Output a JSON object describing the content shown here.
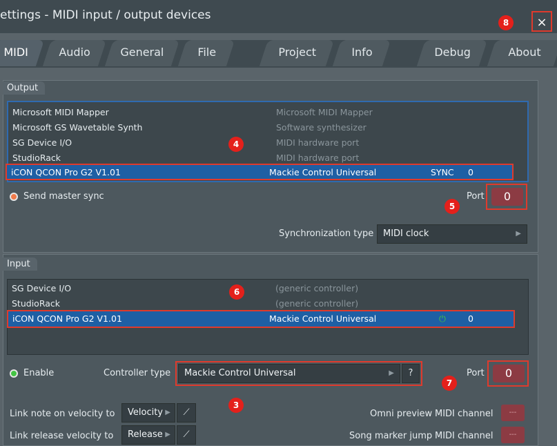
{
  "window": {
    "title": "ettings - MIDI input / output devices",
    "close_glyph": "×"
  },
  "tabs": [
    {
      "label": "MIDI"
    },
    {
      "label": "Audio"
    },
    {
      "label": "General"
    },
    {
      "label": "File"
    },
    {
      "label": "Project"
    },
    {
      "label": "Info"
    },
    {
      "label": "Debug"
    },
    {
      "label": "About"
    }
  ],
  "output": {
    "section_label": "Output",
    "devices": [
      {
        "name": "Microsoft MIDI Mapper",
        "type": "Microsoft MIDI Mapper",
        "sync": "",
        "port": ""
      },
      {
        "name": "Microsoft GS Wavetable Synth",
        "type": "Software synthesizer",
        "sync": "",
        "port": ""
      },
      {
        "name": "SG Device I/O",
        "type": "MIDI hardware port",
        "sync": "",
        "port": ""
      },
      {
        "name": "StudioRack",
        "type": "MIDI hardware port",
        "sync": "",
        "port": ""
      },
      {
        "name": "iCON QCON Pro G2 V1.01",
        "type": "Mackie Control Universal",
        "sync": "SYNC",
        "port": "0"
      }
    ],
    "send_master_sync_label": "Send master sync",
    "port_label": "Port",
    "port_value": "0",
    "sync_type_label": "Synchronization type",
    "sync_type_value": "MIDI clock"
  },
  "input": {
    "section_label": "Input",
    "devices": [
      {
        "name": "SG Device I/O",
        "type": "(generic controller)",
        "status": "",
        "port": ""
      },
      {
        "name": "StudioRack",
        "type": "(generic controller)",
        "status": "",
        "port": ""
      },
      {
        "name": "iCON QCON Pro G2 V1.01",
        "type": "Mackie Control Universal",
        "status": "power-icon",
        "port": "0"
      }
    ],
    "enable_label": "Enable",
    "controller_type_label": "Controller type",
    "controller_type_value": "Mackie Control Universal",
    "help_glyph": "?",
    "port_label": "Port",
    "port_value": "0",
    "link_note_label": "Link note on velocity to",
    "link_note_value": "Velocity",
    "link_release_label": "Link release velocity to",
    "link_release_value": "Release",
    "omni_label": "Omni preview",
    "omni_suffix": "MIDI channel",
    "song_marker_label": "Song marker jump",
    "song_marker_suffix": "MIDI channel",
    "mini_port_value": "---"
  },
  "annotations": [
    "8",
    "4",
    "5",
    "6",
    "3",
    "7"
  ],
  "colors": {
    "accent_red": "#e4201b",
    "selection_blue": "#1e5fa4",
    "port_red": "#8c3b43",
    "enabled_green": "#43c443",
    "sync_orange": "#f07a4a"
  }
}
